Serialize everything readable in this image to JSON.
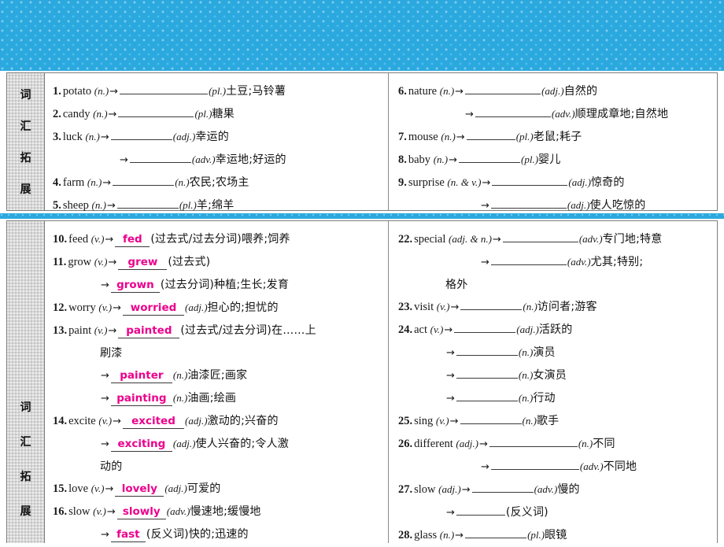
{
  "page": {
    "banner_color": "#2BA9DF",
    "answer_color": "#EC008C",
    "rail_color": "#d8d8d8"
  },
  "rail": {
    "label_chars": [
      "词",
      "汇",
      "拓",
      "展"
    ]
  },
  "sections": [
    {
      "id": "section-top",
      "left_column": [
        {
          "lines": [
            {
              "num": "1.",
              "word": "potato",
              "pos": "(n.)",
              "arrow": "→",
              "blank": "",
              "blank_size": "w-xl",
              "tail_pos": "(pl.)",
              "cn": "土豆;马铃薯"
            }
          ]
        },
        {
          "lines": [
            {
              "num": "2.",
              "word": "candy",
              "pos": "(n.)",
              "arrow": "→",
              "blank": "",
              "blank_size": "w-lg",
              "tail_pos": "(pl.)",
              "cn": "糖果"
            }
          ]
        },
        {
          "lines": [
            {
              "num": "3.",
              "word": "luck",
              "pos": "(n.)",
              "arrow": "→",
              "blank": "",
              "blank_size": "w-md",
              "tail_pos": "(adj.)",
              "cn": "幸运的"
            },
            {
              "num": "",
              "word": "",
              "pos": "",
              "arrow": "→",
              "blank": "",
              "blank_size": "w-md",
              "tail_pos": "(adv.)",
              "cn": "幸运地;好运的",
              "indent": "sub"
            }
          ]
        },
        {
          "lines": [
            {
              "num": "4.",
              "word": "farm",
              "pos": "(n.)",
              "arrow": "→",
              "blank": "",
              "blank_size": "w-md",
              "tail_pos": "(n.)",
              "cn": "农民;农场主"
            }
          ]
        },
        {
          "lines": [
            {
              "num": "5.",
              "word": "sheep",
              "pos": "(n.)",
              "arrow": "→",
              "blank": "",
              "blank_size": "w-md",
              "tail_pos": "(pl.)",
              "cn": "羊;绵羊"
            }
          ]
        }
      ],
      "right_column": [
        {
          "lines": [
            {
              "num": "6.",
              "word": "nature",
              "pos": "(n.)",
              "arrow": "→",
              "blank": "",
              "blank_size": "w-lg",
              "tail_pos": "(adj.)",
              "cn": "自然的"
            },
            {
              "num": "",
              "word": "",
              "pos": "",
              "arrow": "→",
              "blank": "",
              "blank_size": "w-lg",
              "tail_pos": "(adv.)",
              "cn": "顺理成章地;自然地",
              "indent": "sub"
            }
          ]
        },
        {
          "lines": [
            {
              "num": "7.",
              "word": "mouse",
              "pos": "(n.)",
              "arrow": "→",
              "blank": "",
              "blank_size": "w-sm",
              "tail_pos": "(pl.)",
              "cn": "老鼠;耗子"
            }
          ]
        },
        {
          "lines": [
            {
              "num": "8.",
              "word": "baby",
              "pos": "(n.)",
              "arrow": "→",
              "blank": "",
              "blank_size": "w-md",
              "tail_pos": "(pl.)",
              "cn": "婴儿"
            }
          ]
        },
        {
          "lines": [
            {
              "num": "9.",
              "word": "surprise",
              "pos": "(n. & v.)",
              "arrow": "→",
              "blank": "",
              "blank_size": "w-lg",
              "tail_pos": "(adj.)",
              "cn": "惊奇的"
            },
            {
              "num": "",
              "word": "",
              "pos": "",
              "arrow": "→",
              "blank": "",
              "blank_size": "w-lg",
              "tail_pos": "(adj.)",
              "cn": "使人吃惊的",
              "indent": "sub2"
            }
          ]
        }
      ]
    },
    {
      "id": "section-bottom",
      "left_column": [
        {
          "lines": [
            {
              "num": "10.",
              "word": "feed",
              "pos": "(v.)",
              "arrow": "→",
              "blank": "fed",
              "blank_size": "w-xs",
              "tail_pos": "",
              "cn": "(过去式/过去分词)喂养;饲养"
            }
          ]
        },
        {
          "lines": [
            {
              "num": "11.",
              "word": "grow",
              "pos": "(v.)",
              "arrow": "→",
              "blank": "grew",
              "blank_size": "w-sm",
              "tail_pos": "",
              "cn": "(过去式)"
            },
            {
              "num": "",
              "word": "",
              "pos": "",
              "arrow": "→",
              "blank": "grown",
              "blank_size": "w-sm",
              "tail_pos": "",
              "cn": "(过去分词)种植;生长;发育",
              "indent": "sub3"
            }
          ]
        },
        {
          "lines": [
            {
              "num": "12.",
              "word": "worry",
              "pos": "(v.)",
              "arrow": "→",
              "blank": "worried",
              "blank_size": "w-md",
              "tail_pos": "(adj.)",
              "cn": "担心的;担忧的"
            }
          ]
        },
        {
          "lines": [
            {
              "num": "13.",
              "word": "paint",
              "pos": "(v.)",
              "arrow": "→",
              "blank": "painted",
              "blank_size": "w-md",
              "tail_pos": "",
              "cn": "(过去式/过去分词)在……上"
            },
            {
              "cont": "刷漆"
            },
            {
              "num": "",
              "word": "",
              "pos": "",
              "arrow": "→",
              "blank": "painter",
              "blank_size": "w-md",
              "tail_pos": "(n.)",
              "cn": "油漆匠;画家",
              "indent": "sub3"
            },
            {
              "num": "",
              "word": "",
              "pos": "",
              "arrow": "→",
              "blank": "painting",
              "blank_size": "w-md",
              "tail_pos": "(n.)",
              "cn": "油画;绘画",
              "indent": "sub3"
            }
          ]
        },
        {
          "lines": [
            {
              "num": "14.",
              "word": "excite",
              "pos": "(v.)",
              "arrow": "→",
              "blank": "excited",
              "blank_size": "w-md",
              "tail_pos": "(adj.)",
              "cn": "激动的;兴奋的"
            },
            {
              "num": "",
              "word": "",
              "pos": "",
              "arrow": "→",
              "blank": "exciting",
              "blank_size": "w-md",
              "tail_pos": "(adj.)",
              "cn": "使人兴奋的;令人激",
              "indent": "sub3"
            },
            {
              "cont": "动的"
            }
          ]
        },
        {
          "lines": [
            {
              "num": "15.",
              "word": "love",
              "pos": "(v.)",
              "arrow": "→",
              "blank": "lovely",
              "blank_size": "w-sm",
              "tail_pos": "(adj.)",
              "cn": "可爱的"
            }
          ]
        },
        {
          "lines": [
            {
              "num": "16.",
              "word": "slow",
              "pos": "(v.)",
              "arrow": "→",
              "blank": "slowly",
              "blank_size": "w-sm",
              "tail_pos": "(adv.)",
              "cn": "慢速地;缓慢地"
            },
            {
              "num": "",
              "word": "",
              "pos": "",
              "arrow": "→",
              "blank": "fast",
              "blank_size": "w-xs",
              "tail_pos": "",
              "cn": "(反义词)快的;迅速的",
              "indent": "sub3"
            }
          ]
        }
      ],
      "right_column": [
        {
          "lines": [
            {
              "num": "22.",
              "word": "special",
              "pos": "(adj. & n.)",
              "arrow": "→",
              "blank": "",
              "blank_size": "w-lg",
              "tail_pos": "(adv.)",
              "cn": "专门地;特意"
            },
            {
              "num": "",
              "word": "",
              "pos": "",
              "arrow": "→",
              "blank": "",
              "blank_size": "w-lg",
              "tail_pos": "(adv.)",
              "cn": "尤其;特别;",
              "indent": "sub2"
            },
            {
              "cont": "格外"
            }
          ]
        },
        {
          "lines": [
            {
              "num": "23.",
              "word": "visit",
              "pos": "(v.)",
              "arrow": "→",
              "blank": "",
              "blank_size": "w-md",
              "tail_pos": "(n.)",
              "cn": "访问者;游客"
            }
          ]
        },
        {
          "lines": [
            {
              "num": "24.",
              "word": "act",
              "pos": "(v.)",
              "arrow": "→",
              "blank": "",
              "blank_size": "w-md",
              "tail_pos": "(adj.)",
              "cn": "活跃的"
            },
            {
              "num": "",
              "word": "",
              "pos": "",
              "arrow": "→",
              "blank": "",
              "blank_size": "w-md",
              "tail_pos": "(n.)",
              "cn": "演员",
              "indent": "sub3"
            },
            {
              "num": "",
              "word": "",
              "pos": "",
              "arrow": "→",
              "blank": "",
              "blank_size": "w-md",
              "tail_pos": "(n.)",
              "cn": "女演员",
              "indent": "sub3"
            },
            {
              "num": "",
              "word": "",
              "pos": "",
              "arrow": "→",
              "blank": "",
              "blank_size": "w-md",
              "tail_pos": "(n.)",
              "cn": "行动",
              "indent": "sub3"
            }
          ]
        },
        {
          "lines": [
            {
              "num": "25.",
              "word": "sing",
              "pos": "(v.)",
              "arrow": "→",
              "blank": "",
              "blank_size": "w-md",
              "tail_pos": "(n.)",
              "cn": "歌手"
            }
          ]
        },
        {
          "lines": [
            {
              "num": "26.",
              "word": "different",
              "pos": "(adj.)",
              "arrow": "→",
              "blank": "",
              "blank_size": "w-xl",
              "tail_pos": "(n.)",
              "cn": "不同"
            },
            {
              "num": "",
              "word": "",
              "pos": "",
              "arrow": "→",
              "blank": "",
              "blank_size": "w-xl",
              "tail_pos": "(adv.)",
              "cn": "不同地",
              "indent": "sub2"
            }
          ]
        },
        {
          "lines": [
            {
              "num": "27.",
              "word": "slow",
              "pos": "(adj.)",
              "arrow": "→",
              "blank": "",
              "blank_size": "w-md",
              "tail_pos": "(adv.)",
              "cn": "慢的"
            },
            {
              "num": "",
              "word": "",
              "pos": "",
              "arrow": "→",
              "blank": "",
              "blank_size": "w-sm",
              "tail_pos": "",
              "cn": "(反义词)",
              "indent": "sub3"
            }
          ]
        },
        {
          "lines": [
            {
              "num": "28.",
              "word": "glass",
              "pos": "(n.)",
              "arrow": "→",
              "blank": "",
              "blank_size": "w-md",
              "tail_pos": "(pl.)",
              "cn": "眼镜"
            }
          ]
        }
      ]
    }
  ]
}
